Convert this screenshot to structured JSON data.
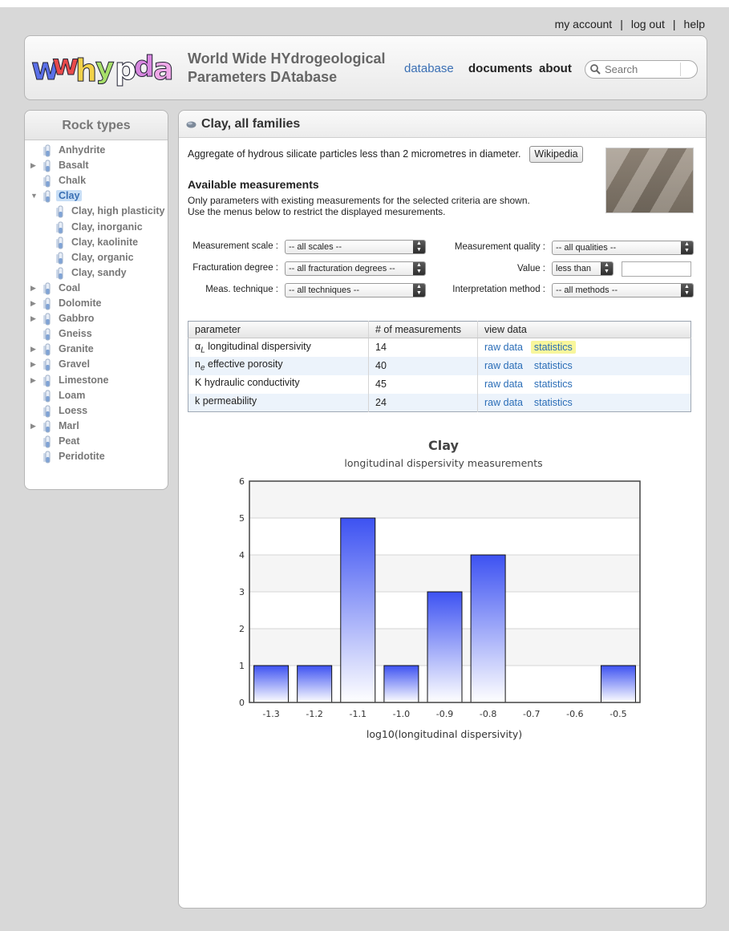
{
  "top_links": {
    "account": "my account",
    "logout": "log out",
    "help": "help"
  },
  "header": {
    "logo_text": "wwhypda",
    "title_line1": "World Wide HYdrogeological",
    "title_line2": "Parameters DAtabase",
    "nav": {
      "database": "database",
      "documents": "documents",
      "about": "about"
    },
    "search_placeholder": "Search"
  },
  "sidebar": {
    "title": "Rock types",
    "items": [
      {
        "label": "Anhydrite",
        "level": 0,
        "arrow": ""
      },
      {
        "label": "Basalt",
        "level": 0,
        "arrow": "▶"
      },
      {
        "label": "Chalk",
        "level": 0,
        "arrow": ""
      },
      {
        "label": "Clay",
        "level": 0,
        "arrow": "▼",
        "selected": true
      },
      {
        "label": "Clay, high plasticity",
        "level": 1,
        "arrow": ""
      },
      {
        "label": "Clay, inorganic",
        "level": 1,
        "arrow": ""
      },
      {
        "label": "Clay, kaolinite",
        "level": 1,
        "arrow": ""
      },
      {
        "label": "Clay, organic",
        "level": 1,
        "arrow": ""
      },
      {
        "label": "Clay, sandy",
        "level": 1,
        "arrow": ""
      },
      {
        "label": "Coal",
        "level": 0,
        "arrow": "▶"
      },
      {
        "label": "Dolomite",
        "level": 0,
        "arrow": "▶"
      },
      {
        "label": "Gabbro",
        "level": 0,
        "arrow": "▶"
      },
      {
        "label": "Gneiss",
        "level": 0,
        "arrow": ""
      },
      {
        "label": "Granite",
        "level": 0,
        "arrow": "▶"
      },
      {
        "label": "Gravel",
        "level": 0,
        "arrow": "▶"
      },
      {
        "label": "Limestone",
        "level": 0,
        "arrow": "▶"
      },
      {
        "label": "Loam",
        "level": 0,
        "arrow": ""
      },
      {
        "label": "Loess",
        "level": 0,
        "arrow": ""
      },
      {
        "label": "Marl",
        "level": 0,
        "arrow": "▶"
      },
      {
        "label": "Peat",
        "level": 0,
        "arrow": ""
      },
      {
        "label": "Peridotite",
        "level": 0,
        "arrow": ""
      }
    ]
  },
  "main": {
    "title": "Clay, all families",
    "description": "Aggregate of hydrous silicate particles less than 2 micrometres in diameter.",
    "wiki_button": "Wikipedia",
    "available_title": "Available measurements",
    "available_line1": "Only parameters with existing measurements for the selected criteria are shown.",
    "available_line2": "Use the menus below to restrict the displayed mesurements.",
    "filters": {
      "scale_label": "Measurement scale :",
      "scale_value": "-- all scales --",
      "quality_label": "Measurement quality :",
      "quality_value": "-- all qualities --",
      "fracturation_label": "Fracturation degree :",
      "fracturation_value": "-- all fracturation degrees --",
      "value_label": "Value :",
      "value_op": "less than",
      "value_input": "",
      "technique_label": "Meas. technique :",
      "technique_value": "-- all techniques --",
      "interpretation_label": "Interpretation method :",
      "interpretation_value": "-- all methods --"
    },
    "table": {
      "headers": [
        "parameter",
        "# of measurements",
        "view data"
      ],
      "rows": [
        {
          "symbol": "α",
          "sub": "L",
          "name": "longitudinal dispersivity",
          "count": "14",
          "raw": "raw data",
          "stats": "statistics"
        },
        {
          "symbol": "n",
          "sub": "e",
          "name": "effective porosity",
          "count": "40",
          "raw": "raw data",
          "stats": "statistics"
        },
        {
          "symbol": "K",
          "sub": "",
          "name": "hydraulic conductivity",
          "count": "45",
          "raw": "raw data",
          "stats": "statistics"
        },
        {
          "symbol": "k",
          "sub": "",
          "name": "permeability",
          "count": "24",
          "raw": "raw data",
          "stats": "statistics"
        }
      ]
    }
  },
  "chart_data": {
    "type": "bar",
    "title": "Clay",
    "subtitle": "longitudinal dispersivity measurements",
    "xlabel": "log10(longitudinal dispersivity)",
    "ylabel": "",
    "categories": [
      "-1.3",
      "-1.2",
      "-1.1",
      "-1.0",
      "-0.9",
      "-0.8",
      "-0.7",
      "-0.6",
      "-0.5"
    ],
    "values": [
      1,
      1,
      5,
      1,
      3,
      4,
      0,
      0,
      1
    ],
    "ylim": [
      0,
      6
    ],
    "yticks": [
      "0",
      "1",
      "2",
      "3",
      "4",
      "5",
      "6"
    ],
    "grid": true,
    "bar_color_top": "#3d52f2",
    "bar_color_bottom": "#ffffff"
  }
}
